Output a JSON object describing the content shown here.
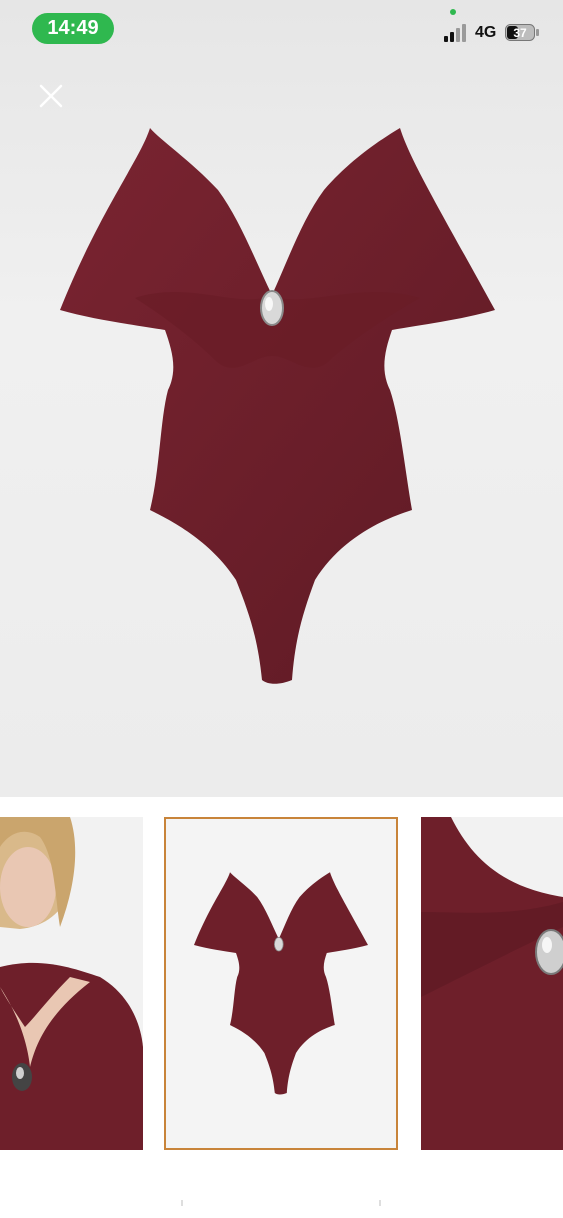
{
  "status_bar": {
    "time": "14:49",
    "network": "4G",
    "battery": "37"
  },
  "colors": {
    "time_pill": "#2fb84f",
    "garment": "#6e1f2a",
    "thumb_border": "#c8843a"
  },
  "icons": {
    "close": "close-icon",
    "signal": "signal-icon",
    "battery": "battery-icon"
  },
  "gallery": {
    "selected_index": 1,
    "thumbnails": [
      "model-front",
      "product-flat",
      "detail-closeup"
    ]
  }
}
